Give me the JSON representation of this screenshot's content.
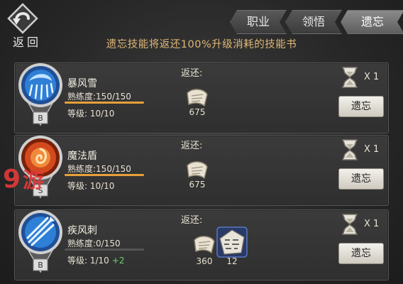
{
  "nav": {
    "back_label": "返回"
  },
  "tabs": [
    {
      "label": "职业",
      "active": false
    },
    {
      "label": "领悟",
      "active": false
    },
    {
      "label": "遗忘",
      "active": true
    }
  ],
  "notice": "遗忘技能将返还100%升级消耗的技能书",
  "skills": [
    {
      "name": "暴风雪",
      "mastery": "熟练度:150/150",
      "mastery_fraction": 1.0,
      "level": "等级: 10/10",
      "level_bonus": "",
      "grade": "B",
      "return_label": "返还:",
      "return_items": [
        {
          "icon": "scroll-book",
          "count": "675"
        }
      ],
      "hourglass_count": "X 1",
      "button": "遗忘",
      "emblem_color": "#2e7fd6"
    },
    {
      "name": "魔法盾",
      "mastery": "熟练度:150/150",
      "mastery_fraction": 1.0,
      "level": "等级: 10/10",
      "level_bonus": "",
      "grade": "S",
      "return_label": "返还:",
      "return_items": [
        {
          "icon": "scroll-book",
          "count": "675"
        }
      ],
      "hourglass_count": "X 1",
      "button": "遗忘",
      "emblem_color": "#d24a1e"
    },
    {
      "name": "疾风刺",
      "mastery": "熟练度:0/150",
      "mastery_fraction": 0.0,
      "level": "等级: 1/10",
      "level_bonus": "+2",
      "grade": "B",
      "return_label": "返还:",
      "return_items": [
        {
          "icon": "scroll-book",
          "count": "360"
        },
        {
          "icon": "rune-tome",
          "count": "12"
        }
      ],
      "hourglass_count": "X 1",
      "button": "遗忘",
      "emblem_color": "#2e7fd6"
    }
  ],
  "watermark": {
    "logo_text": "9游"
  },
  "colors": {
    "accent": "#e7a03a",
    "notice": "#e0b878",
    "bonus": "#6ad36a"
  }
}
